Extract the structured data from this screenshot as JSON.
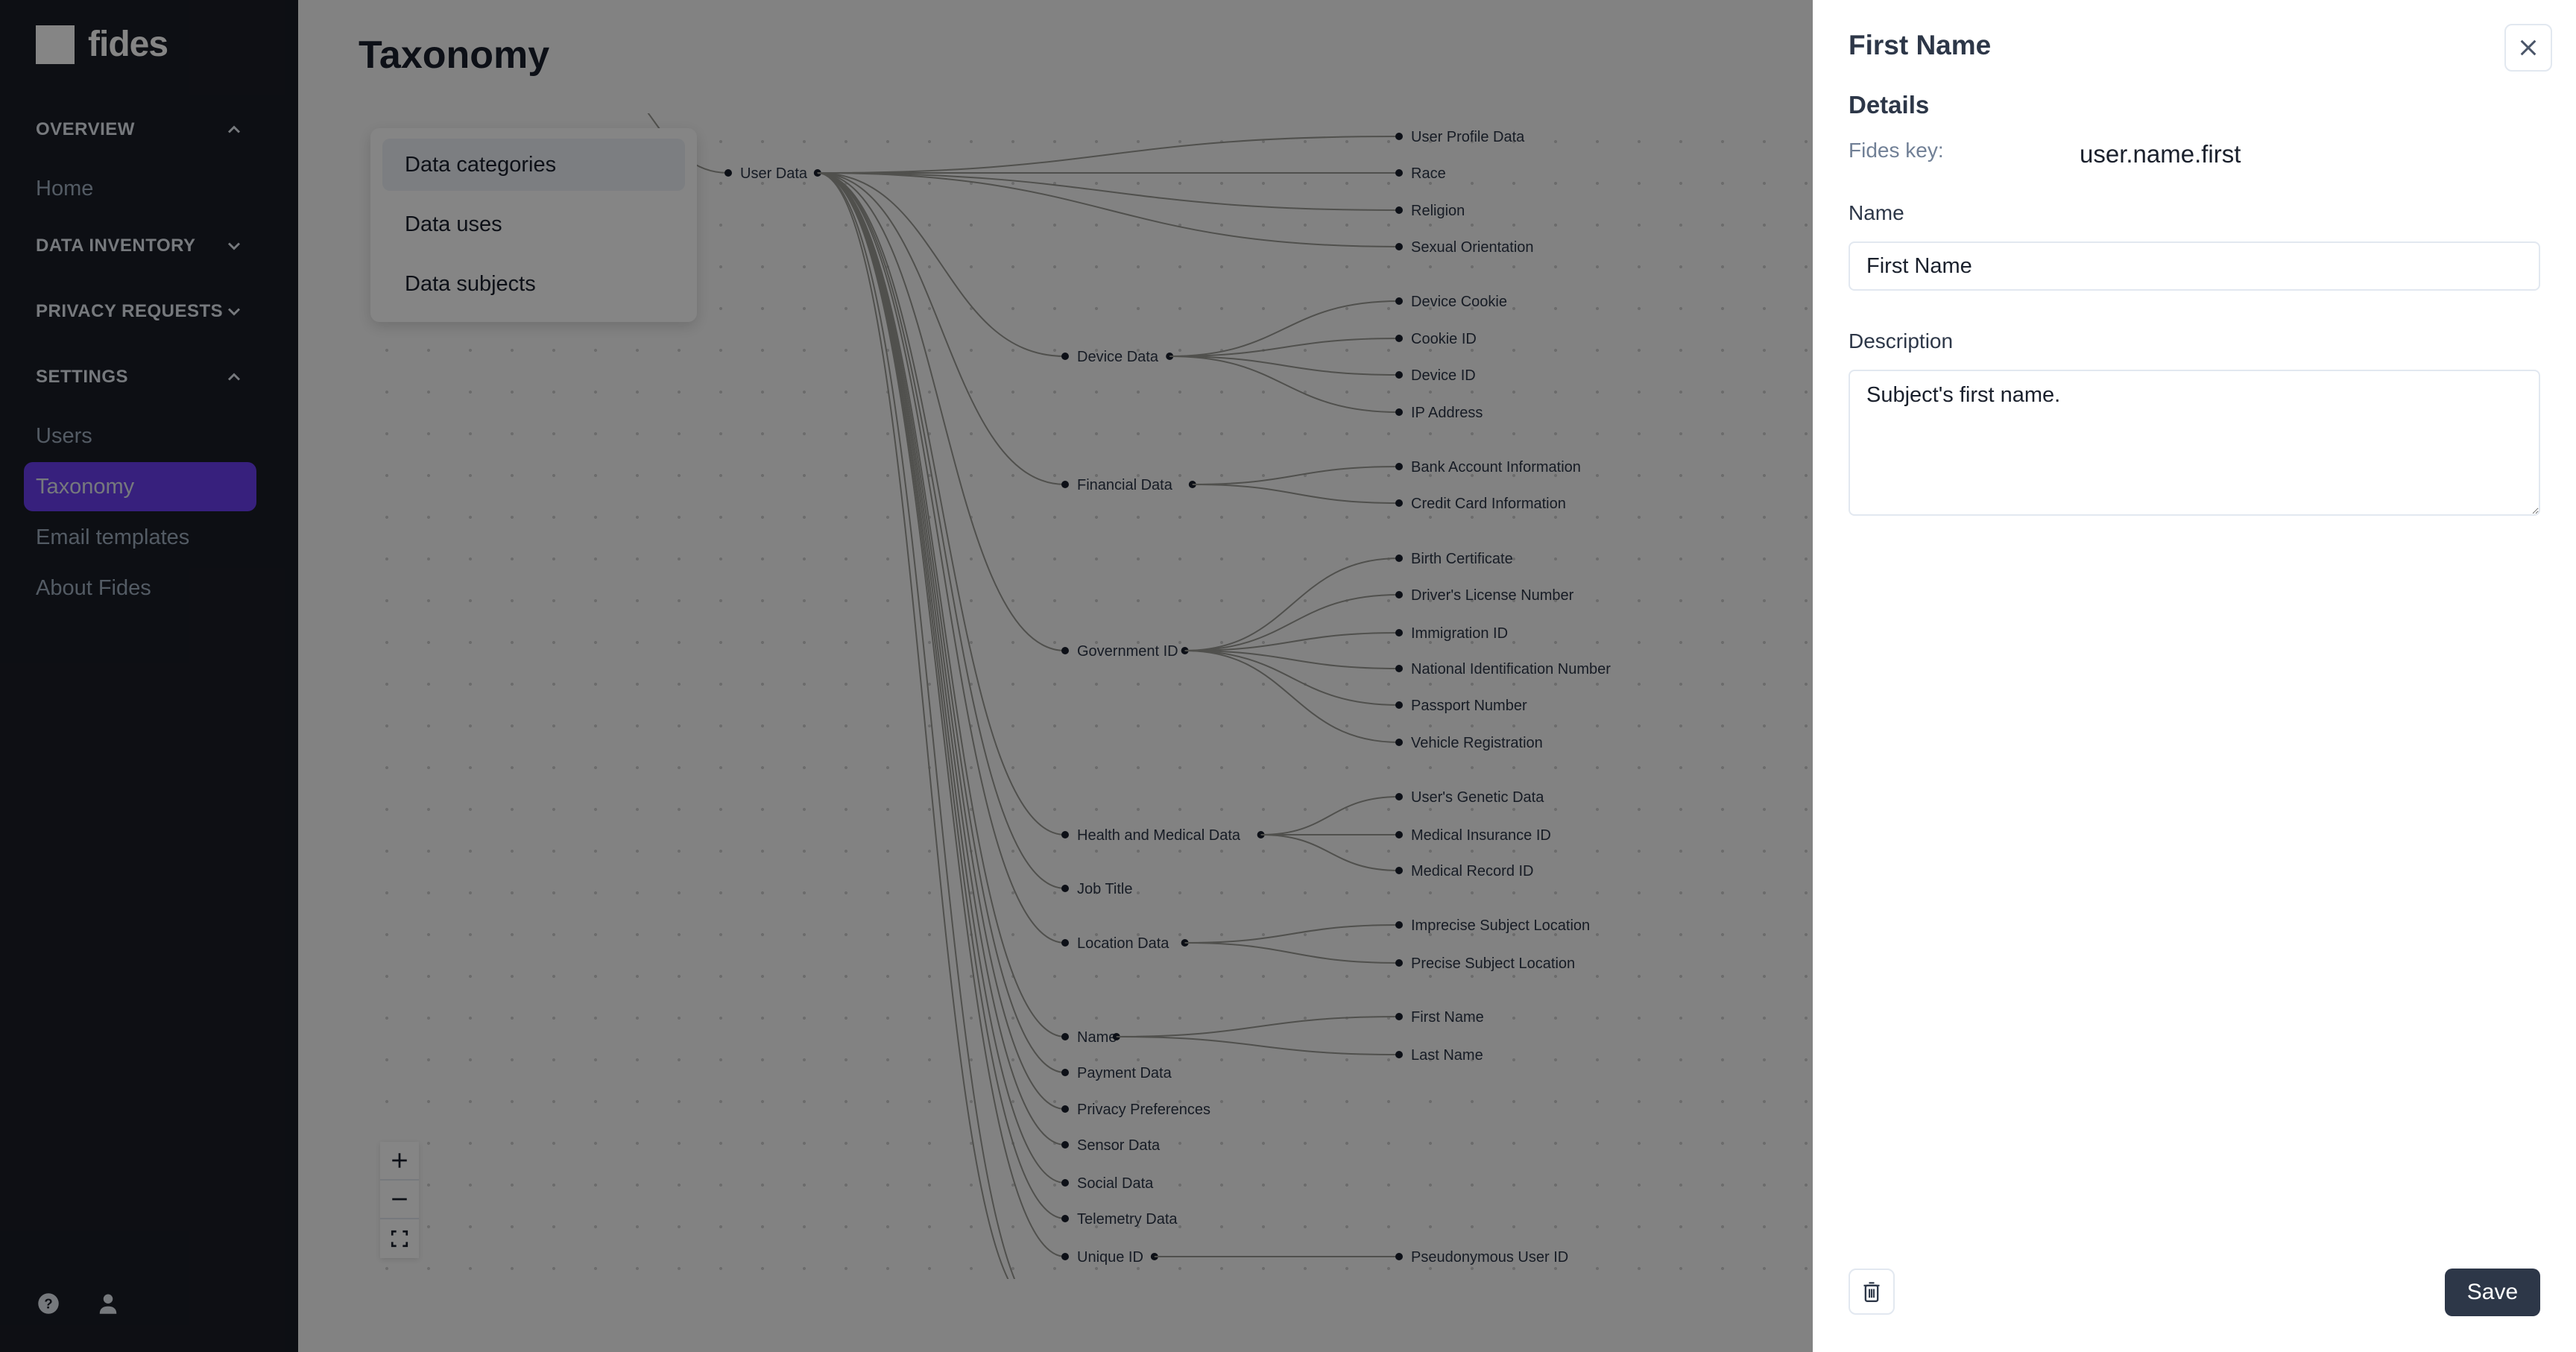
{
  "app": {
    "logo_text": "fides"
  },
  "sidebar": {
    "sections": [
      {
        "label": "OVERVIEW",
        "expanded": true
      },
      {
        "label": "DATA INVENTORY",
        "expanded": false
      },
      {
        "label": "PRIVACY REQUESTS",
        "expanded": false
      },
      {
        "label": "SETTINGS",
        "expanded": true
      }
    ],
    "items": [
      {
        "label": "Home",
        "section": "OVERVIEW",
        "active": false
      },
      {
        "label": "Users",
        "section": "SETTINGS",
        "active": false
      },
      {
        "label": "Taxonomy",
        "section": "SETTINGS",
        "active": true
      },
      {
        "label": "Email templates",
        "section": "SETTINGS",
        "active": false
      },
      {
        "label": "About Fides",
        "section": "SETTINGS",
        "active": false
      }
    ],
    "bottom_icons": [
      "help-icon",
      "user-icon"
    ]
  },
  "main": {
    "title": "Taxonomy",
    "type_menu": {
      "items": [
        "Data categories",
        "Data uses",
        "Data subjects"
      ],
      "selected": "Data categories"
    },
    "zoom_controls": [
      "zoom-in",
      "zoom-out",
      "fit-view"
    ]
  },
  "tree": {
    "root": "User Data",
    "children": [
      {
        "label": "User Profile Data",
        "level": 2
      },
      {
        "label": "Race",
        "level": 2
      },
      {
        "label": "Religion",
        "level": 2
      },
      {
        "label": "Sexual Orientation",
        "level": 2
      },
      {
        "label": "Device Data",
        "children": [
          "Device Cookie",
          "Cookie ID",
          "Device ID",
          "IP Address"
        ]
      },
      {
        "label": "Financial Data",
        "children": [
          "Bank Account Information",
          "Credit Card Information"
        ]
      },
      {
        "label": "Government ID",
        "children": [
          "Birth Certificate",
          "Driver's License Number",
          "Immigration ID",
          "National Identification Number",
          "Passport Number",
          "Vehicle Registration"
        ]
      },
      {
        "label": "Health and Medical Data",
        "children": [
          "User's Genetic Data",
          "Medical Insurance ID",
          "Medical Record ID"
        ]
      },
      {
        "label": "Job Title",
        "children": []
      },
      {
        "label": "Location Data",
        "children": [
          "Imprecise Subject Location",
          "Precise Subject Location"
        ]
      },
      {
        "label": "Name",
        "children": [
          "First Name",
          "Last Name"
        ]
      },
      {
        "label": "Payment Data",
        "children": []
      },
      {
        "label": "Privacy Preferences",
        "children": []
      },
      {
        "label": "Sensor Data",
        "children": []
      },
      {
        "label": "Social Data",
        "children": []
      },
      {
        "label": "Telemetry Data",
        "children": []
      },
      {
        "label": "Unique ID",
        "children": [
          "Pseudonymous User ID"
        ]
      }
    ]
  },
  "drawer": {
    "title": "First Name",
    "section_title": "Details",
    "fides_key_label": "Fides key:",
    "fides_key_value": "user.name.first",
    "name_label": "Name",
    "name_value": "First Name",
    "description_label": "Description",
    "description_value": "Subject's first name.",
    "save_label": "Save"
  },
  "colors": {
    "sidebar_bg": "#1a1d27",
    "active_item": "#6a3ff0",
    "save_button": "#2d3748"
  }
}
